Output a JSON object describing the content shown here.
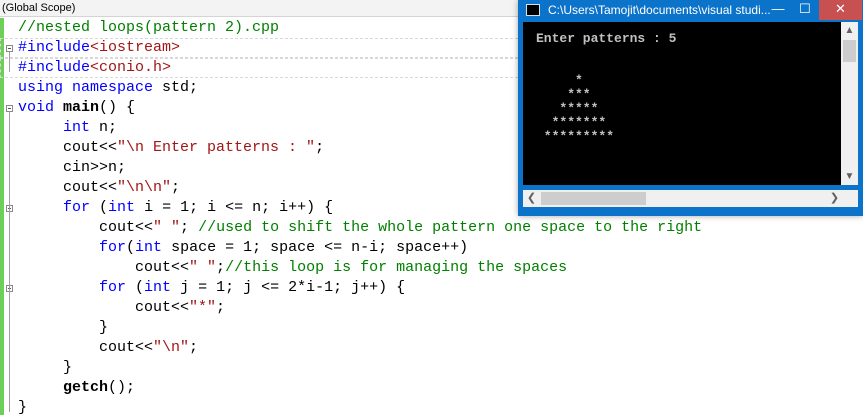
{
  "scope_bar": {
    "label": "(Global Scope)"
  },
  "code_lines": [
    {
      "parts": [
        [
          "c",
          "//nested loops(pattern 2).cpp"
        ]
      ]
    },
    {
      "parts": [
        [
          "k",
          "#include"
        ],
        [
          "s",
          "<iostream>"
        ]
      ]
    },
    {
      "parts": [
        [
          "k",
          "#include"
        ],
        [
          "s",
          "<conio.h>"
        ]
      ]
    },
    {
      "parts": [
        [
          "k",
          "using"
        ],
        [
          "d",
          " "
        ],
        [
          "k",
          "namespace"
        ],
        [
          "d",
          " std;"
        ]
      ]
    },
    {
      "parts": [
        [
          "k",
          "void"
        ],
        [
          "d",
          " "
        ],
        [
          "b",
          "main"
        ],
        [
          "d",
          "() {"
        ]
      ]
    },
    {
      "parts": [
        [
          "d",
          "     "
        ],
        [
          "k",
          "int"
        ],
        [
          "d",
          " n;"
        ]
      ]
    },
    {
      "parts": [
        [
          "d",
          "     cout<<"
        ],
        [
          "s",
          "\"\\n Enter patterns : \""
        ],
        [
          "d",
          ";"
        ]
      ]
    },
    {
      "parts": [
        [
          "d",
          "     cin>>n;"
        ]
      ]
    },
    {
      "parts": [
        [
          "d",
          "     cout<<"
        ],
        [
          "s",
          "\"\\n\\n\""
        ],
        [
          "d",
          ";"
        ]
      ]
    },
    {
      "parts": [
        [
          "d",
          "     "
        ],
        [
          "k",
          "for"
        ],
        [
          "d",
          " ("
        ],
        [
          "k",
          "int"
        ],
        [
          "d",
          " i = 1; i <= n; i++) {"
        ]
      ]
    },
    {
      "parts": [
        [
          "d",
          "         cout<<"
        ],
        [
          "s",
          "\" \""
        ],
        [
          "d",
          "; "
        ],
        [
          "c",
          "//used to shift the whole pattern one space to the right"
        ]
      ]
    },
    {
      "parts": [
        [
          "d",
          "         "
        ],
        [
          "k",
          "for"
        ],
        [
          "d",
          "("
        ],
        [
          "k",
          "int"
        ],
        [
          "d",
          " space = 1; space <= n-i; space++)"
        ]
      ]
    },
    {
      "parts": [
        [
          "d",
          "             cout<<"
        ],
        [
          "s",
          "\" \""
        ],
        [
          "d",
          ";"
        ],
        [
          "c",
          "//this loop is for managing the spaces"
        ]
      ]
    },
    {
      "parts": [
        [
          "d",
          "         "
        ],
        [
          "k",
          "for"
        ],
        [
          "d",
          " ("
        ],
        [
          "k",
          "int"
        ],
        [
          "d",
          " j = 1; j <= 2*i-1; j++) {"
        ]
      ]
    },
    {
      "parts": [
        [
          "d",
          "             cout<<"
        ],
        [
          "s",
          "\"*\""
        ],
        [
          "d",
          ";"
        ]
      ]
    },
    {
      "parts": [
        [
          "d",
          "         }"
        ]
      ]
    },
    {
      "parts": [
        [
          "d",
          "         cout<<"
        ],
        [
          "s",
          "\"\\n\""
        ],
        [
          "d",
          ";"
        ]
      ]
    },
    {
      "parts": [
        [
          "d",
          "     }"
        ]
      ]
    },
    {
      "parts": [
        [
          "d",
          "     "
        ],
        [
          "b",
          "getch"
        ],
        [
          "d",
          "();"
        ]
      ]
    },
    {
      "parts": [
        [
          "d",
          "}"
        ]
      ]
    }
  ],
  "console": {
    "title": "C:\\Users\\Tamojit\\documents\\visual studi...",
    "minimize_label": "—",
    "maximize_label": "☐",
    "close_label": "✕",
    "output": "Enter patterns : 5\n\n\n     *\n    ***\n   *****\n  *******\n *********",
    "scroll_up": "▲",
    "scroll_down": "▼",
    "scroll_left": "❮",
    "scroll_right": "❯"
  },
  "colors": {
    "keyword": "#0000ff",
    "comment": "#008000",
    "string": "#a31515",
    "accent": "#0b73c9",
    "close": "#c75050"
  }
}
